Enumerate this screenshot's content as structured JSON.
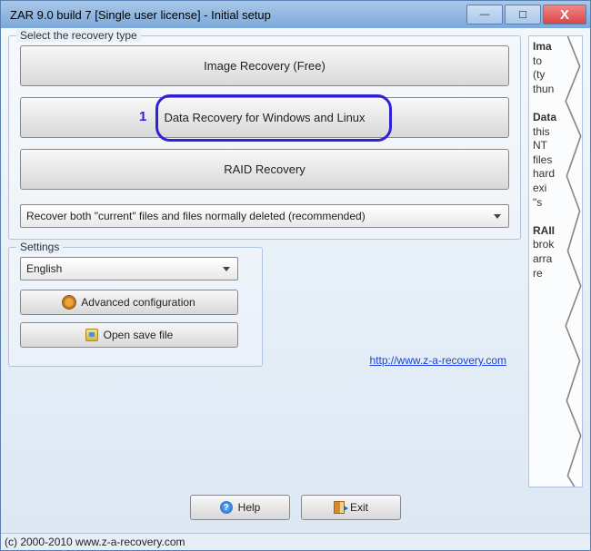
{
  "window": {
    "title": "ZAR 9.0 build 7 [Single user license] - Initial setup"
  },
  "main": {
    "group_label": "Select the recovery type",
    "buttons": {
      "image": "Image Recovery (Free)",
      "data": "Data Recovery for Windows and Linux",
      "raid": "RAID Recovery"
    },
    "annotation_num": "1",
    "mode_select": "Recover both \"current\" files and files normally deleted (recommended)"
  },
  "settings": {
    "group_label": "Settings",
    "language": "English",
    "advanced": "Advanced configuration",
    "open_save": "Open save file"
  },
  "link": {
    "text": "http://www.z-a-recovery.com"
  },
  "right_panel": {
    "p1": "Ima",
    "p1b": "to",
    "p1c": "(ty",
    "p1d": "thun",
    "p2": "Data",
    "p2b": "this",
    "p2c": "NT",
    "p2d": "files",
    "p2e": "hard",
    "p2f": "exi",
    "p2g": "\"s",
    "p3": "RAII",
    "p3b": "brok",
    "p3c": "arra",
    "p3d": "re"
  },
  "bottom": {
    "help": "Help",
    "exit": "Exit"
  },
  "copyright": "(c) 2000-2010 www.z-a-recovery.com"
}
